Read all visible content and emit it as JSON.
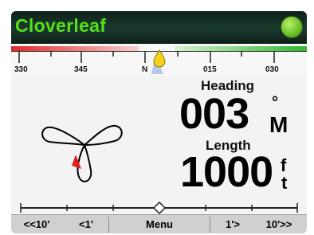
{
  "title_bar": {
    "title": "Cloverleaf",
    "status_color": "#6fc22d"
  },
  "compass": {
    "labels": [
      "330",
      "345",
      "N",
      "015",
      "030"
    ],
    "colors": {
      "port": "#e02828",
      "starboard": "#2cb82c",
      "marker": "#f2d21a"
    }
  },
  "heading": {
    "label": "Heading",
    "value": "003",
    "degree_symbol": "°",
    "unit": "M"
  },
  "length": {
    "label": "Length",
    "value": "1000",
    "unit_top": "f",
    "unit_bottom": "t"
  },
  "pattern": {
    "name": "cloverleaf",
    "boat_marker_color": "#e02020"
  },
  "buttons": {
    "left_10": "<<10'",
    "left_1": "<1'",
    "menu": "Menu",
    "right_1": "1'>",
    "right_10": "10'>>"
  }
}
